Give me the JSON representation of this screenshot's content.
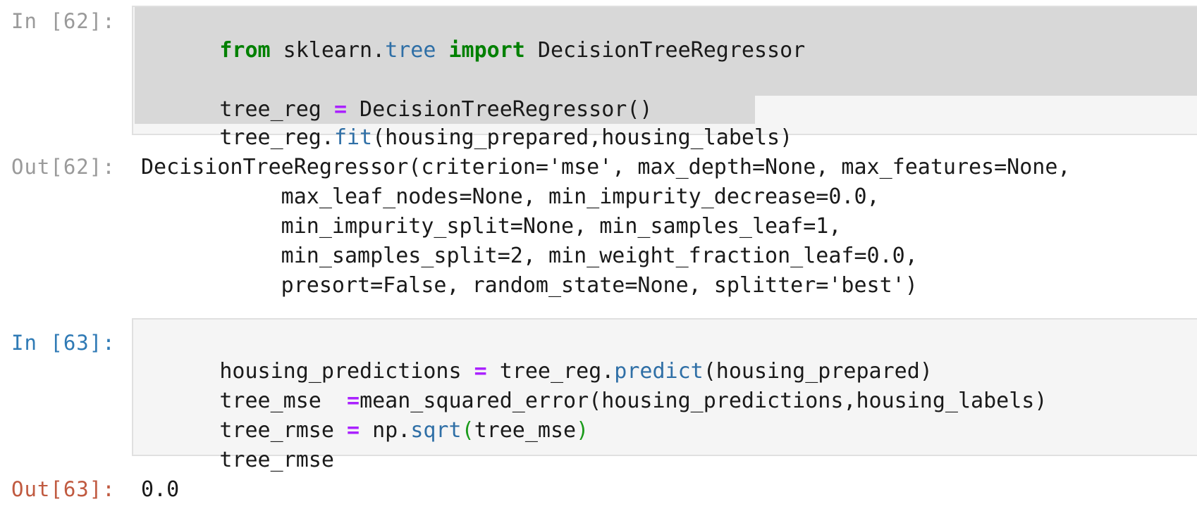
{
  "cells": {
    "c62": {
      "in_prompt": "In [62]:",
      "out_prompt": "Out[62]:",
      "code": {
        "l1_kw_from": "from",
        "l1_mod": " sklearn.",
        "l1_sub": "tree",
        "l1_kw_import": "import",
        "l1_cls": " DecisionTreeRegressor",
        "l3_var": "tree_reg ",
        "l3_eq": "=",
        "l3_rest": " DecisionTreeRegressor()",
        "l4_var": "tree_reg.",
        "l4_fn": "fit",
        "l4_rest": "(housing_prepared,housing_labels)"
      },
      "output": [
        "DecisionTreeRegressor(criterion='mse', max_depth=None, max_features=None,",
        "           max_leaf_nodes=None, min_impurity_decrease=0.0,",
        "           min_impurity_split=None, min_samples_leaf=1,",
        "           min_samples_split=2, min_weight_fraction_leaf=0.0,",
        "           presort=False, random_state=None, splitter='best')"
      ]
    },
    "c63": {
      "in_prompt": "In [63]:",
      "out_prompt": "Out[63]:",
      "code": {
        "l1_var": "housing_predictions ",
        "l1_eq": "=",
        "l1_mid": " tree_reg.",
        "l1_fn": "predict",
        "l1_rest": "(housing_prepared)",
        "l2_var": "tree_mse  ",
        "l2_eq": "=",
        "l2_rest": "mean_squared_error(housing_predictions,housing_labels)",
        "l3_var": "tree_rmse ",
        "l3_eq": "=",
        "l3_mid": " np.",
        "l3_fn": "sqrt",
        "l3_po": "(",
        "l3_arg": "tree_mse",
        "l3_pc": ")",
        "l4_var": "tree_rmse"
      },
      "output": "0.0"
    }
  },
  "colors": {
    "keyword": "#008000",
    "operator": "#aa22ff",
    "function": "#2f6fa6",
    "in_prompt_active": "#2f7ab5",
    "out_prompt_active": "#c05a40",
    "prompt_inactive": "#9a9a9a",
    "selection": "#d8d8d8",
    "input_bg": "#f5f5f5"
  }
}
